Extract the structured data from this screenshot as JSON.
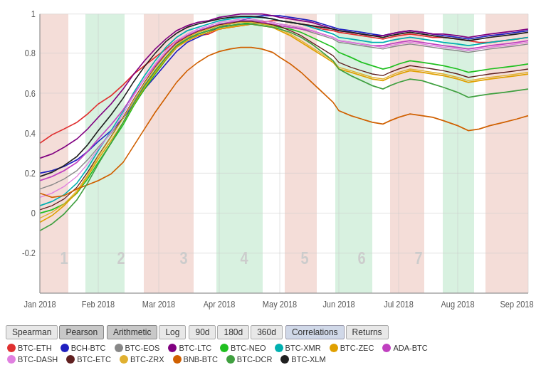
{
  "title": "Pearson Arithmetic Log Correlations Returns",
  "controls": {
    "group1": [
      {
        "label": "Spearman",
        "active": false
      },
      {
        "label": "Pearson",
        "active": true
      }
    ],
    "group2": [
      {
        "label": "Arithmetic",
        "active": true
      },
      {
        "label": "Log",
        "active": false
      }
    ],
    "group3": [
      {
        "label": "90d",
        "active": false
      },
      {
        "label": "180d",
        "active": false
      },
      {
        "label": "360d",
        "active": false
      }
    ],
    "group4": [
      {
        "label": "Correlations",
        "active": true
      },
      {
        "label": "Returns",
        "active": false
      }
    ]
  },
  "xLabels": [
    "Jan 2018",
    "Feb 2018",
    "Mar 2018",
    "Apr 2018",
    "May 2018",
    "Jun 2018",
    "Jul 2018",
    "Aug 2018",
    "Sep 2018"
  ],
  "yLabels": [
    "1",
    "0.8",
    "0.6",
    "0.4",
    "0.2",
    "0",
    "-0.2"
  ],
  "legend": [
    {
      "label": "BTC-ETH",
      "color": "#e03030"
    },
    {
      "label": "BCH-BTC",
      "color": "#2020c0"
    },
    {
      "label": "BTC-EOS",
      "color": "#808080"
    },
    {
      "label": "BTC-LTC",
      "color": "#800080"
    },
    {
      "label": "BTC-NEO",
      "color": "#20c020"
    },
    {
      "label": "BTC-XMR",
      "color": "#00b0b0"
    },
    {
      "label": "BTC-ZEC",
      "color": "#e0a000"
    },
    {
      "label": "ADA-BTC",
      "color": "#c040c0"
    },
    {
      "label": "BTC-DASH",
      "color": "#e080e0"
    },
    {
      "label": "BTC-ETC",
      "color": "#602020"
    },
    {
      "label": "BTC-ZRX",
      "color": "#e0b030"
    },
    {
      "label": "BNB-BTC",
      "color": "#d06000"
    },
    {
      "label": "BTC-DCR",
      "color": "#40a040"
    },
    {
      "label": "BTC-XLM",
      "color": "#202020"
    }
  ],
  "bands": [
    {
      "x": 0,
      "w": 5,
      "type": "red"
    },
    {
      "x": 9,
      "w": 6,
      "type": "green"
    },
    {
      "x": 17,
      "w": 8,
      "type": "red"
    },
    {
      "x": 26,
      "w": 7,
      "type": "green"
    },
    {
      "x": 36,
      "w": 5,
      "type": "red"
    },
    {
      "x": 43,
      "w": 6,
      "type": "green"
    },
    {
      "x": 51,
      "w": 6,
      "type": "red"
    },
    {
      "x": 59,
      "w": 5,
      "type": "green"
    },
    {
      "x": 66,
      "w": 8,
      "type": "red"
    }
  ],
  "periodLabels": [
    {
      "x": 6.5,
      "label": "1"
    },
    {
      "x": 14,
      "label": "2"
    },
    {
      "x": 22,
      "label": "3"
    },
    {
      "x": 31,
      "label": "4"
    },
    {
      "x": 39,
      "label": "5"
    },
    {
      "x": 47,
      "label": "6"
    },
    {
      "x": 54.5,
      "label": "7"
    }
  ]
}
